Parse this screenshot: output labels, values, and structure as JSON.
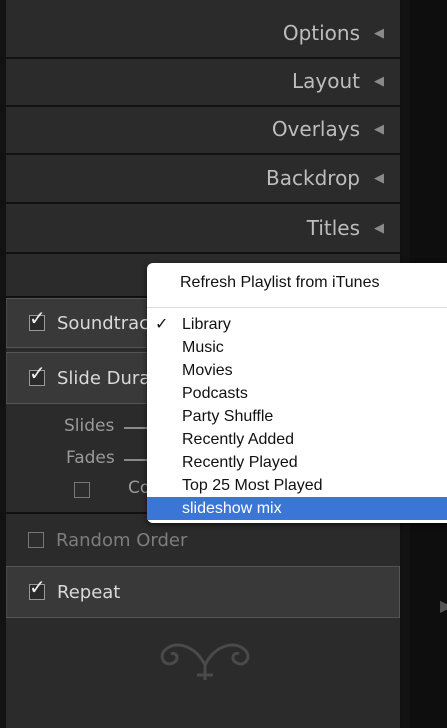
{
  "sections": [
    {
      "label": "Options",
      "icon": "collapse-triangle-icon"
    },
    {
      "label": "Layout",
      "icon": "collapse-triangle-icon"
    },
    {
      "label": "Overlays",
      "icon": "collapse-triangle-icon"
    },
    {
      "label": "Backdrop",
      "icon": "collapse-triangle-icon"
    },
    {
      "label": "Titles",
      "icon": "collapse-triangle-icon"
    }
  ],
  "playback": {
    "soundtrack_label": "Soundtrac",
    "soundtrack_checked": true,
    "slide_duration_label": "Slide Dura",
    "slide_duration_checked": true,
    "slides_label": "Slides",
    "fades_label": "Fades",
    "color_label": "Co",
    "color_checked": false,
    "random_order_label": "Random Order",
    "random_order_checked": false,
    "repeat_label": "Repeat",
    "repeat_checked": true
  },
  "menu": {
    "refresh_label": "Refresh Playlist from iTunes",
    "items": [
      {
        "label": "Library",
        "checked": true
      },
      {
        "label": "Music",
        "checked": false
      },
      {
        "label": "Movies",
        "checked": false
      },
      {
        "label": "Podcasts",
        "checked": false
      },
      {
        "label": "Party Shuffle",
        "checked": false
      },
      {
        "label": "Recently Added",
        "checked": false
      },
      {
        "label": "Recently Played",
        "checked": false
      },
      {
        "label": "Top 25 Most Played",
        "checked": false
      },
      {
        "label": "slideshow mix",
        "checked": false,
        "selected": true
      }
    ],
    "check_glyph": "✓"
  },
  "glyphs": {
    "triangle": "◀",
    "checkmark": "✓",
    "right_arrow": "▶"
  },
  "colors": {
    "panel_bg": "#2b2b2b",
    "menu_highlight": "#3b76d6"
  }
}
